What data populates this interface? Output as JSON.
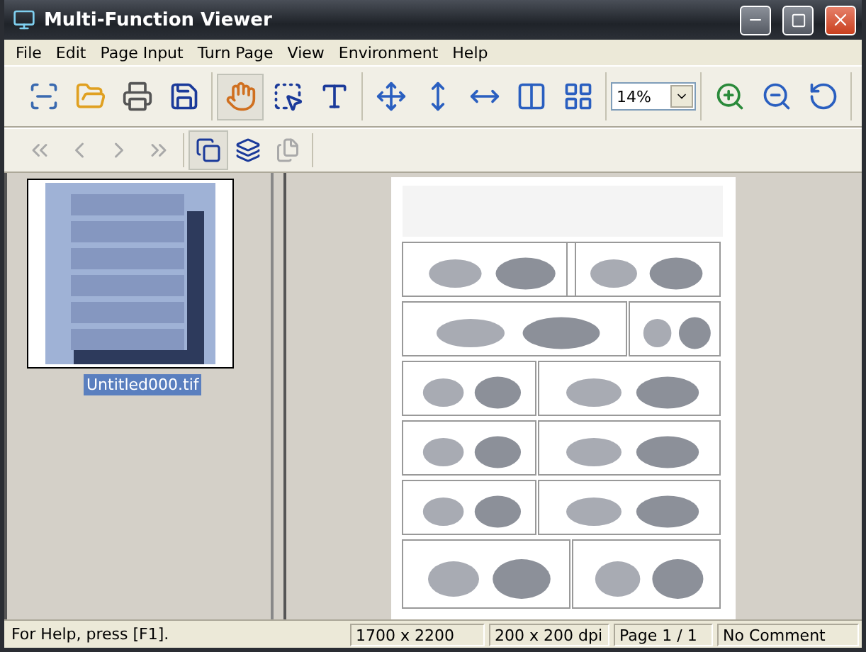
{
  "window": {
    "title": "Multi-Function Viewer"
  },
  "menu": [
    "File",
    "Edit",
    "Page Input",
    "Turn Page",
    "View",
    "Environment",
    "Help"
  ],
  "toolbar": [
    [
      {
        "kind": "button",
        "selected": false
      },
      {
        "kind": "button",
        "selected": false
      },
      {
        "kind": "button",
        "selected": false
      },
      {
        "kind": "button",
        "selected": false
      }
    ],
    [
      {
        "kind": "button",
        "selected": true
      },
      {
        "kind": "button",
        "selected": false
      },
      {
        "kind": "button",
        "selected": false
      }
    ],
    [
      {
        "kind": "button",
        "selected": false
      },
      {
        "kind": "button",
        "selected": false
      },
      {
        "kind": "button",
        "selected": false
      },
      {
        "kind": "button",
        "selected": false
      },
      {
        "kind": "button",
        "selected": false
      }
    ],
    [
      {
        "kind": "zoom",
        "value": "14%"
      }
    ],
    [
      {
        "kind": "button",
        "selected": false
      },
      {
        "kind": "button",
        "selected": false
      },
      {
        "kind": "button",
        "selected": false
      }
    ]
  ],
  "page_toolbar": [
    [
      {
        "selected": false,
        "disabled": true
      },
      {
        "selected": false,
        "disabled": true
      },
      {
        "selected": false,
        "disabled": true
      },
      {
        "selected": false,
        "disabled": true
      }
    ],
    [
      {
        "selected": true,
        "disabled": false
      },
      {
        "selected": false,
        "disabled": false
      },
      {
        "selected": false,
        "disabled": true
      }
    ]
  ],
  "thumbnails": [
    {
      "name": "Untitled000.tif",
      "selected": true
    }
  ],
  "status_bar": {
    "help": "For Help, press [F1].",
    "size": "1700 x 2200",
    "resolution": "200 x 200 dpi",
    "page": "Page 1 / 1",
    "comment": "No Comment"
  }
}
